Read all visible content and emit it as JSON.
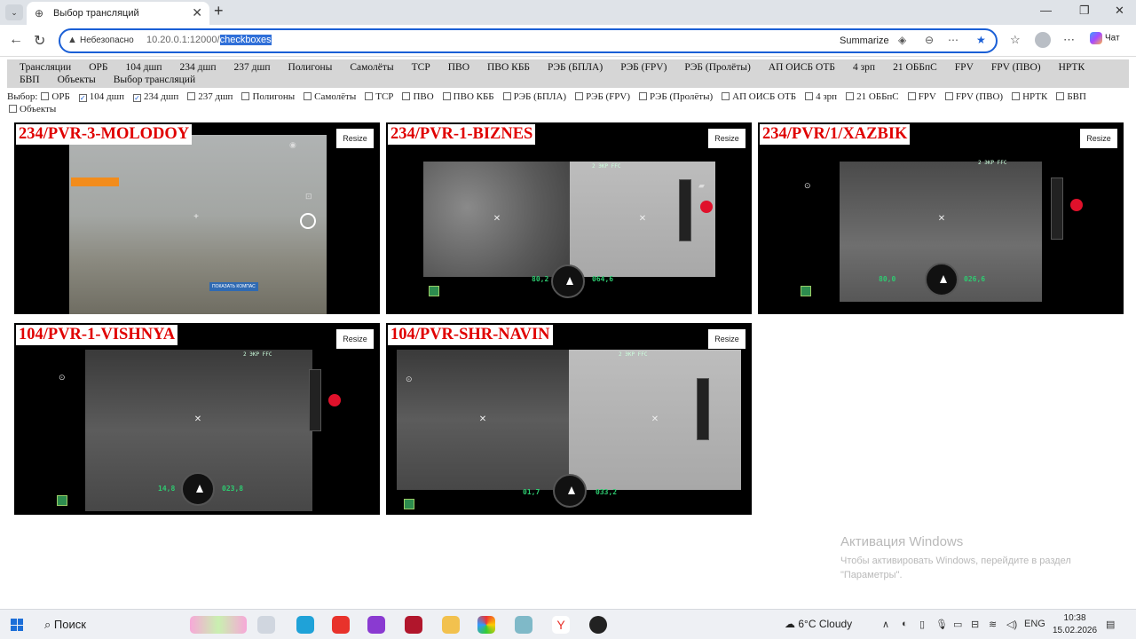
{
  "browser": {
    "tab_title": "Выбор трансляций",
    "not_secure": "Небезопасно",
    "url_host": "10.20.0.1:12000/",
    "url_path": "checkboxes",
    "summarize": "Summarize",
    "chat_label": "Чат"
  },
  "navbar": {
    "items": [
      "Трансляции",
      "ОРБ",
      "104 дшп",
      "234 дшп",
      "237 дшп",
      "Полигоны",
      "Самолёты",
      "ТСР",
      "ПВО",
      "ПВО КББ",
      "РЭБ (БПЛА)",
      "РЭБ (FPV)",
      "РЭБ (Пролёты)",
      "АП ОИСБ ОТБ",
      "4 зрп",
      "21 ОББпС",
      "FPV",
      "FPV (ПВО)",
      "НРТК",
      "БВП",
      "Объекты",
      "Выбор трансляций"
    ]
  },
  "filters": {
    "prefix": "Выбор:",
    "options": [
      {
        "label": "ОРБ",
        "checked": false
      },
      {
        "label": "104 дшп",
        "checked": true
      },
      {
        "label": "234 дшп",
        "checked": true
      },
      {
        "label": "237 дшп",
        "checked": false
      },
      {
        "label": "Полигоны",
        "checked": false
      },
      {
        "label": "Самолёты",
        "checked": false
      },
      {
        "label": "ТСР",
        "checked": false
      },
      {
        "label": "ПВО",
        "checked": false
      },
      {
        "label": "ПВО КББ",
        "checked": false
      },
      {
        "label": "РЭБ (БПЛА)",
        "checked": false
      },
      {
        "label": "РЭБ (FPV)",
        "checked": false
      },
      {
        "label": "РЭБ (Пролёты)",
        "checked": false
      },
      {
        "label": "АП ОИСБ ОТБ",
        "checked": false
      },
      {
        "label": "4 зрп",
        "checked": false
      },
      {
        "label": "21 ОББпС",
        "checked": false
      },
      {
        "label": "FPV",
        "checked": false
      },
      {
        "label": "FPV (ПВО)",
        "checked": false
      },
      {
        "label": "НРТК",
        "checked": false
      },
      {
        "label": "БВП",
        "checked": false
      },
      {
        "label": "Объекты",
        "checked": false
      }
    ]
  },
  "streams": [
    {
      "name": "234/PVR-3-MOLODOY",
      "resize": "Resize",
      "kind": "fog",
      "hud_button": "ПОКАЗАТЬ КОМПАС"
    },
    {
      "name": "234/PVR-1-BIZNES",
      "resize": "Resize",
      "kind": "split",
      "alt": "80,2",
      "heading": "064,6",
      "mode": "2 ЭКР FFC"
    },
    {
      "name": "234/PVR/1/XAZBIK",
      "resize": "Resize",
      "kind": "thermal",
      "alt": "80,0",
      "heading": "026,6",
      "mode": "2 ЭКР FFC"
    },
    {
      "name": "104/PVR-1-VISHNYA",
      "resize": "Resize",
      "kind": "thermal",
      "alt": "14,8",
      "heading": "023,8",
      "mode": "2 ЭКР FFC"
    },
    {
      "name": "104/PVR-SHR-NAVIN",
      "resize": "Resize",
      "kind": "split",
      "alt": "01,7",
      "heading": "033,2",
      "mode": "2 ЭКР FFC"
    }
  ],
  "watermark": {
    "title": "Активация Windows",
    "text": "Чтобы активировать Windows, перейдите в раздел \"Параметры\"."
  },
  "taskbar": {
    "search": "Поиск",
    "weather": "6°C  Cloudy",
    "lang": "ENG",
    "time": "10:38",
    "date": "15.02.2026"
  },
  "colors": {
    "stream_label": "#e00000",
    "accent": "#1a5fd6",
    "navbar_bg": "#d6d6d6"
  }
}
